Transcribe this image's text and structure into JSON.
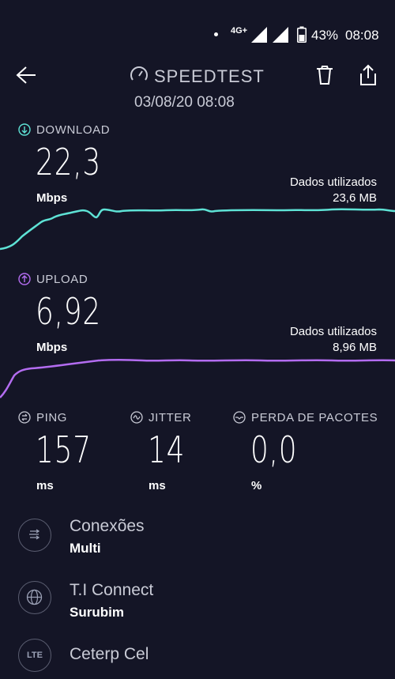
{
  "status_bar": {
    "network": "4G+",
    "battery": "43%",
    "time": "08:08"
  },
  "header": {
    "title": "SPEEDTEST",
    "datetime": "03/08/20 08:08"
  },
  "download": {
    "label": "DOWNLOAD",
    "value": "22,3",
    "unit": "Mbps",
    "used_label": "Dados utilizados",
    "used_value": "23,6 MB",
    "color": "#5ee2d5"
  },
  "upload": {
    "label": "UPLOAD",
    "value": "6,92",
    "unit": "Mbps",
    "used_label": "Dados utilizados",
    "used_value": "8,96 MB",
    "color": "#b36cf0"
  },
  "metrics": {
    "ping": {
      "label": "PING",
      "value": "157",
      "unit": "ms"
    },
    "jitter": {
      "label": "JITTER",
      "value": "14",
      "unit": "ms"
    },
    "loss": {
      "label": "PERDA DE PACOTES",
      "value": "0,0",
      "unit": "%"
    }
  },
  "info": {
    "connections": {
      "title": "Conexões",
      "value": "Multi",
      "icon": "connections-icon"
    },
    "server": {
      "title": "T.I Connect",
      "value": "Surubim",
      "icon": "globe-icon"
    },
    "provider": {
      "title": "Ceterp Cel",
      "icon_text": "LTE"
    }
  }
}
